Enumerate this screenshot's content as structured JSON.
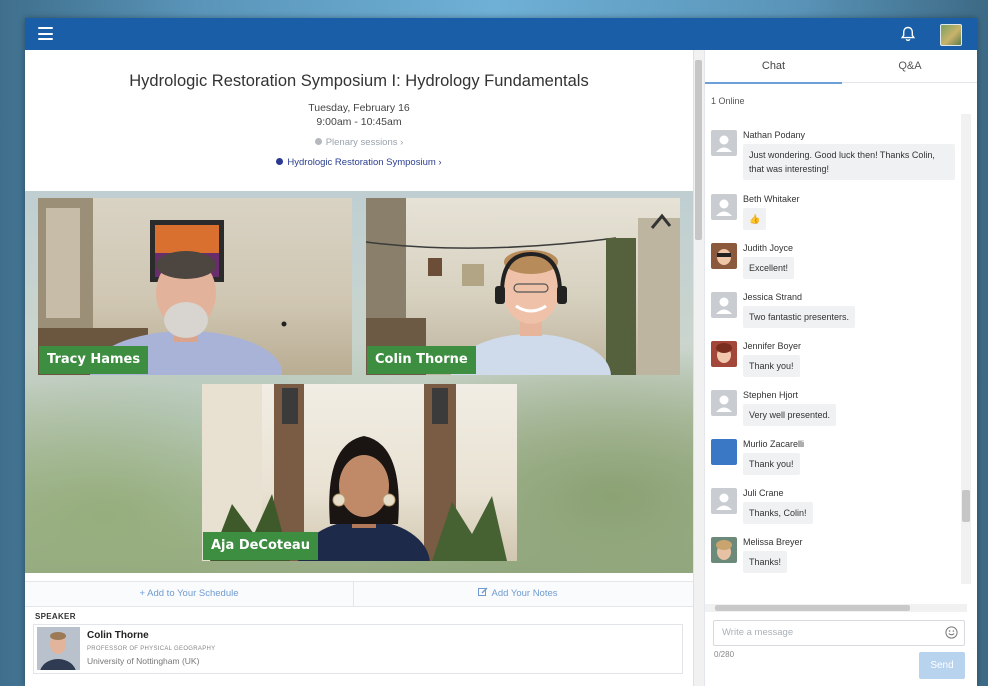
{
  "session": {
    "title": "Hydrologic Restoration Symposium I: Hydrology Fundamentals",
    "date": "Tuesday, February 16",
    "time": "9:00am - 10:45am",
    "tracks": [
      {
        "label": "Plenary sessions ›",
        "color": "#b5b9be"
      },
      {
        "label": "Hydrologic Restoration Symposium ›",
        "color": "#2b3990"
      }
    ]
  },
  "video": {
    "participants": [
      {
        "name": "Tracy Hames"
      },
      {
        "name": "Colin Thorne"
      },
      {
        "name": "Aja DeCoteau"
      }
    ]
  },
  "actions": {
    "schedule": "+ Add to Your Schedule",
    "notes": "Add Your Notes"
  },
  "speaker": {
    "label": "SPEAKER",
    "name": "Colin Thorne",
    "role": "PROFESSOR OF PHYSICAL GEOGRAPHY",
    "org": "University of Nottingham (UK)"
  },
  "chat": {
    "tabs": [
      "Chat",
      "Q&A"
    ],
    "active_tab": "Chat",
    "online": "1 Online",
    "messages": [
      {
        "name": "Nathan Podany",
        "text": "Just wondering. Good luck then! Thanks Colin, that was interesting!",
        "avatar": "default"
      },
      {
        "name": "Beth Whitaker",
        "text": "👍",
        "avatar": "default"
      },
      {
        "name": "Judith Joyce",
        "text": "Excellent!",
        "avatar": "photo"
      },
      {
        "name": "Jessica Strand",
        "text": "Two fantastic presenters.",
        "avatar": "default"
      },
      {
        "name": "Jennifer Boyer",
        "text": "Thank you!",
        "avatar": "photo"
      },
      {
        "name": "Stephen Hjort",
        "text": "Very well presented.",
        "avatar": "default"
      },
      {
        "name": "Murlio Zacarelli",
        "text": "Thank you!",
        "avatar": "blue"
      },
      {
        "name": "Juli Crane",
        "text": "Thanks, Colin!",
        "avatar": "default"
      },
      {
        "name": "Melissa Breyer",
        "text": "Thanks!",
        "avatar": "photo"
      }
    ],
    "compose_placeholder": "Write a message",
    "char_count": "0/280",
    "send_label": "Send"
  },
  "icons": {
    "menu": "menu-icon",
    "notifications": "bell-icon",
    "emoji": "smiley-icon",
    "schedule": "plus-icon",
    "notes": "edit-icon"
  },
  "colors": {
    "topbar": "#1a5ea8",
    "name_tag": "#3e8e41",
    "link": "#6f9bd1",
    "send": "#b8d3ee"
  }
}
